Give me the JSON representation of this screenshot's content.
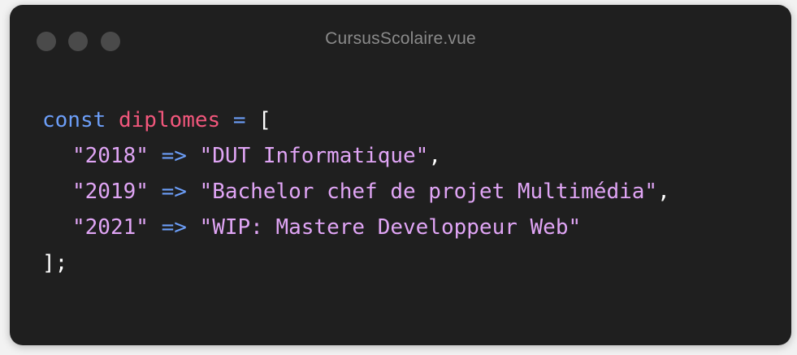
{
  "window": {
    "title": "CursusScolaire.vue"
  },
  "code": {
    "line1": {
      "keyword": "const",
      "variable": "diplomes",
      "operator": "=",
      "bracket_open": "["
    },
    "entries": [
      {
        "key": "\"2018\"",
        "arrow": "=>",
        "value": "\"DUT Informatique\"",
        "sep": ","
      },
      {
        "key": "\"2019\"",
        "arrow": "=>",
        "value": "\"Bachelor chef de projet Multimédia\"",
        "sep": ","
      },
      {
        "key": "\"2021\"",
        "arrow": "=>",
        "value": "\"WIP: Mastere Developpeur Web\"",
        "sep": ""
      }
    ],
    "closing": "];"
  },
  "colors": {
    "keyword": "#6c9ef8",
    "variable": "#f2577c",
    "string": "#e0a5f5",
    "background": "#1f1f1f"
  }
}
